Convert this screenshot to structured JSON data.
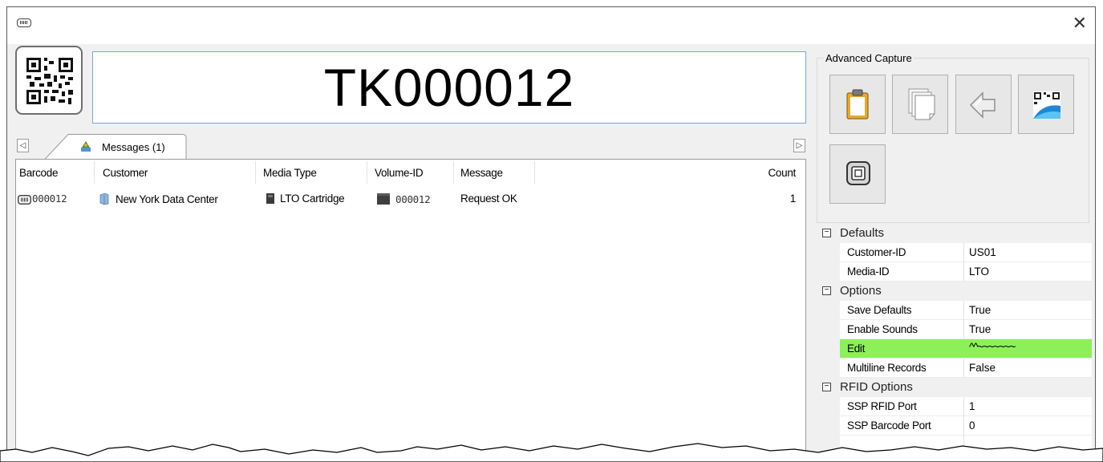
{
  "window": {
    "close_icon": "close-icon"
  },
  "scan": {
    "value": "TK000012"
  },
  "tabs": {
    "messages_label": "Messages (1)",
    "left_arrow": "◁",
    "right_arrow": "▷"
  },
  "columns": [
    "Barcode",
    "Customer",
    "Media Type",
    "Volume-ID",
    "Message",
    "Count"
  ],
  "rows": [
    {
      "barcode": "000012",
      "customer": "New York Data Center",
      "media_type": "LTO Cartridge",
      "volume_id": "000012",
      "message": "Request OK",
      "count": "1"
    }
  ],
  "advanced_capture": {
    "label": "Advanced Capture",
    "buttons": [
      "clipboard-icon",
      "copy-pages-icon",
      "back-arrow-icon",
      "qr-wave-icon",
      "rfid-chip-icon"
    ]
  },
  "properties": {
    "defaults": {
      "label": "Defaults",
      "items": [
        {
          "name": "Customer-ID",
          "value": "US01"
        },
        {
          "name": "Media-ID",
          "value": "LTO"
        }
      ]
    },
    "options": {
      "label": "Options",
      "items": [
        {
          "name": "Save Defaults",
          "value": "True"
        },
        {
          "name": "Enable Sounds",
          "value": "True"
        },
        {
          "name": "Edit",
          "value": "^^~~~~~~~"
        },
        {
          "name": "Multiline Records",
          "value": "False"
        }
      ]
    },
    "rfid": {
      "label": "RFID Options",
      "items": [
        {
          "name": "SSP RFID Port",
          "value": "1"
        },
        {
          "name": "SSP Barcode Port",
          "value": "0"
        }
      ]
    }
  },
  "colors": {
    "highlight": "#8cf05a",
    "focus_border": "#7aa6d4"
  }
}
